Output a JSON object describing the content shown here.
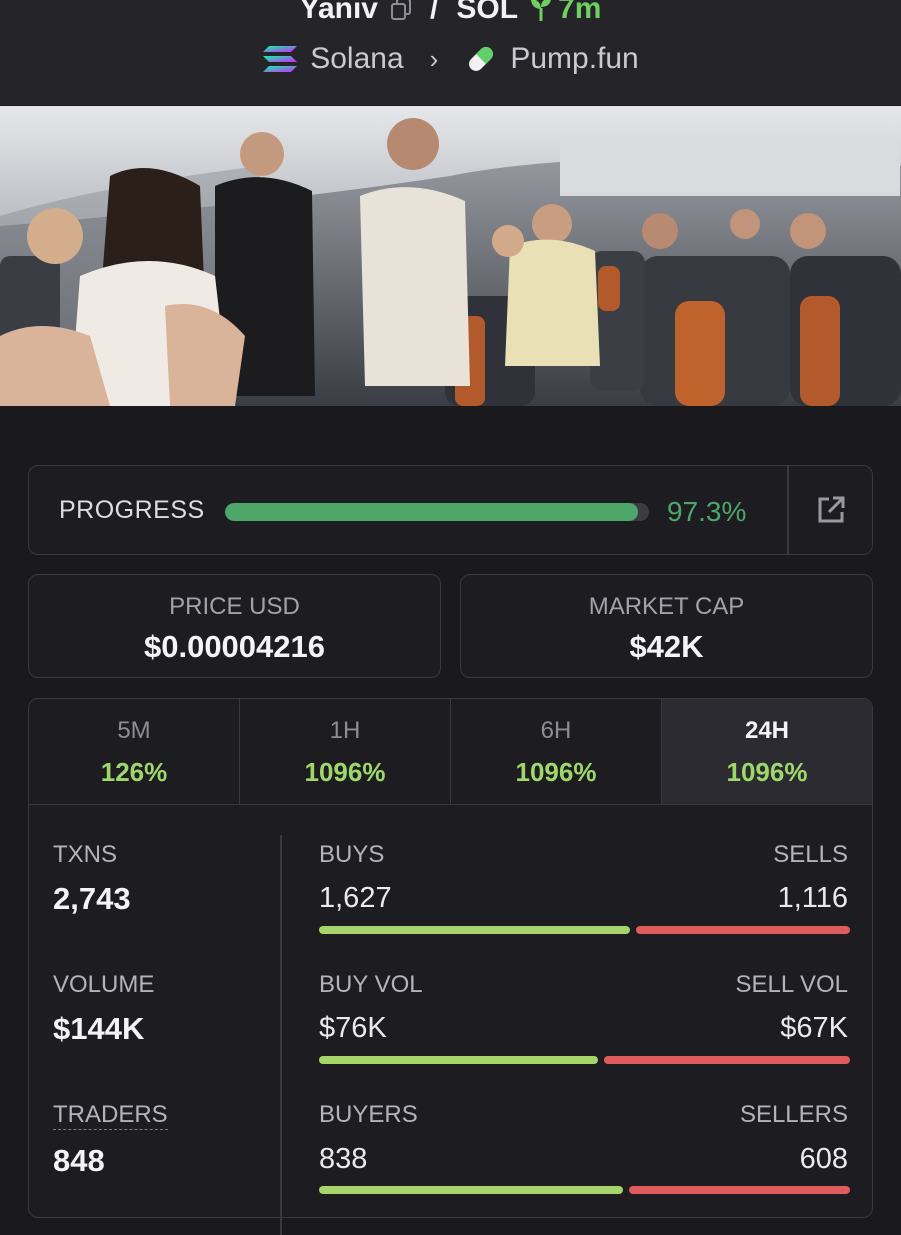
{
  "header": {
    "token_name": "Yaniv",
    "quote": "SOL",
    "age": "7m",
    "chain": "Solana",
    "dex": "Pump.fun",
    "icons": [
      "copy-icon",
      "sprout-icon",
      "solana-logo-icon",
      "chevron-right-icon",
      "pill-icon"
    ]
  },
  "hero": {
    "image_kind": "photo"
  },
  "progress": {
    "label": "PROGRESS",
    "value_text": "97.3%",
    "fraction": 0.973,
    "accent": "#4ea66b"
  },
  "price": {
    "label": "PRICE USD",
    "value": "$0.00004216"
  },
  "market_cap": {
    "label": "MARKET CAP",
    "value": "$42K"
  },
  "timeframes": [
    {
      "label": "5M",
      "change": "126%"
    },
    {
      "label": "1H",
      "change": "1096%"
    },
    {
      "label": "6H",
      "change": "1096%"
    },
    {
      "label": "24H",
      "change": "1096%",
      "active": true
    }
  ],
  "stats": {
    "txns": {
      "label": "TXNS",
      "value": "2,743"
    },
    "volume": {
      "label": "VOLUME",
      "value": "$144K"
    },
    "traders": {
      "label": "TRADERS",
      "value": "848"
    },
    "buys": {
      "label": "BUYS",
      "value": "1,627",
      "share": 0.593
    },
    "sells": {
      "label": "SELLS",
      "value": "1,116"
    },
    "buy_vol": {
      "label": "BUY VOL",
      "value": "$76K",
      "share": 0.531
    },
    "sell_vol": {
      "label": "SELL VOL",
      "value": "$67K"
    },
    "buyers": {
      "label": "BUYERS",
      "value": "838",
      "share": 0.579
    },
    "sellers": {
      "label": "SELLERS",
      "value": "608"
    }
  },
  "colors": {
    "positive": "#9fd86a",
    "buy_bar": "#a6d46a",
    "sell_bar": "#e05b5b",
    "age": "#6fcf5f"
  }
}
